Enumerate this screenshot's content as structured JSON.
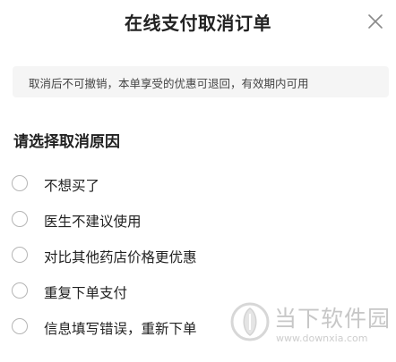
{
  "dialog": {
    "title": "在线支付取消订单",
    "close_icon": "close-icon"
  },
  "notice": {
    "text": "取消后不可撤销，本单享受的优惠可退回，有效期内可用"
  },
  "reasons": {
    "heading": "请选择取消原因",
    "options": [
      {
        "label": "不想买了",
        "selected": false
      },
      {
        "label": "医生不建议使用",
        "selected": false
      },
      {
        "label": "对比其他药店价格更优惠",
        "selected": false
      },
      {
        "label": "重复下单支付",
        "selected": false
      },
      {
        "label": "信息填写错误，重新下单",
        "selected": false
      }
    ]
  },
  "watermark": {
    "name": "当下软件园",
    "url": "www.downxia.com"
  },
  "colors": {
    "notice_bg": "#f5f5f5",
    "radio_border": "#b5b5b5",
    "text": "#222222"
  }
}
